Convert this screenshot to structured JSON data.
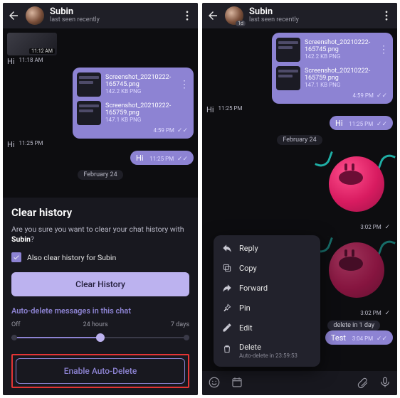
{
  "left": {
    "header": {
      "name": "Subin",
      "status": "last seen recently"
    },
    "imgStubTime": "11:12 AM",
    "hi1": {
      "text": "Hi",
      "time": "11:18 AM"
    },
    "attachments": {
      "files": [
        {
          "name": "Screenshot_20210222-165745.png",
          "size": "142.2 KB PNG"
        },
        {
          "name": "Screenshot_20210222-165759.png",
          "size": "147.1 KB PNG"
        }
      ],
      "time": "4:59 PM"
    },
    "hi2": {
      "text": "Hi",
      "time": "11:25 PM"
    },
    "hi3": {
      "text": "Hi",
      "time": "11:25 PM"
    },
    "dateChip": "February 24",
    "dialog": {
      "title": "Clear history",
      "body_a": "Are you sure you want to clear your chat history with ",
      "body_b": "Subin",
      "body_c": "?",
      "checkboxLabel": "Also clear history for Subin",
      "clearBtn": "Clear History",
      "autoDeleteHeader": "Auto-delete messages in this chat",
      "sliderLabels": {
        "off": "Off",
        "mid": "24 hours",
        "right": "7 days"
      },
      "enableBtn": "Enable Auto-Delete"
    }
  },
  "right": {
    "header": {
      "name": "Subin",
      "status": "last seen recently",
      "badge": "1d"
    },
    "attachments": {
      "files": [
        {
          "name": "Screenshot_20210222-165745.png",
          "size": "142.2 KB PNG"
        },
        {
          "name": "Screenshot_20210222-165759.png",
          "size": "147.1 KB PNG"
        }
      ],
      "time": "4:59 PM"
    },
    "hi1": {
      "text": "Hi",
      "time": "11:25 PM"
    },
    "hi2": {
      "text": "Hi",
      "time": "11:25 PM"
    },
    "dateChip": "February 24",
    "sticker1Time": "3:02 PM",
    "sticker2Time": "3:02 PM",
    "sysChip": "delete in 1 day",
    "testMsg": {
      "text": "Test",
      "time": "3:04 PM"
    },
    "menu": {
      "reply": "Reply",
      "copy": "Copy",
      "forward": "Forward",
      "pin": "Pin",
      "edit": "Edit",
      "delete": "Delete",
      "deleteSub": "Auto-delete in 23:59:53"
    }
  }
}
